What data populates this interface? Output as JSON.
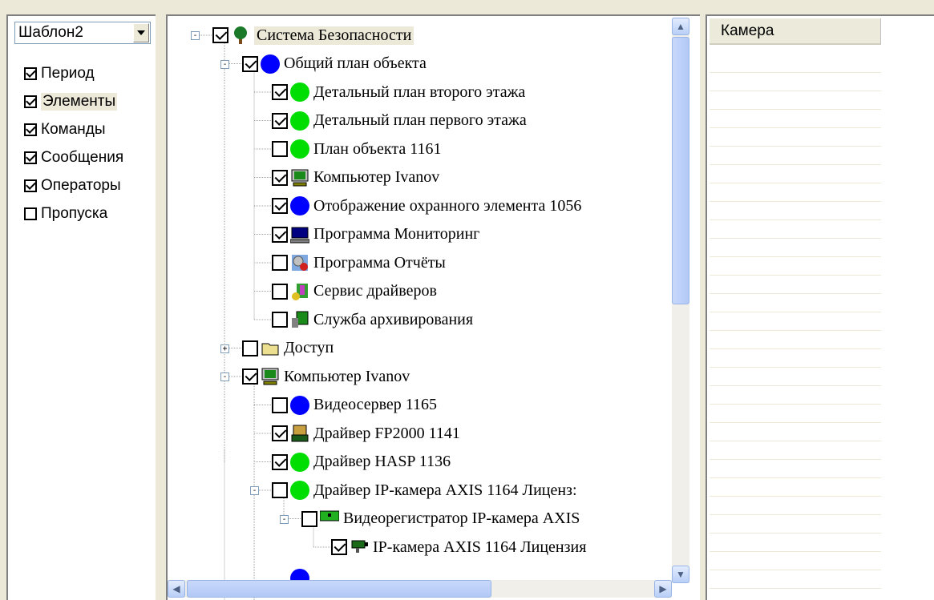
{
  "left_panel": {
    "template_value": "Шаблон2",
    "items": [
      {
        "label": "Период",
        "checked": true
      },
      {
        "label": "Элементы",
        "checked": true,
        "selected": true
      },
      {
        "label": "Команды",
        "checked": true
      },
      {
        "label": "Сообщения",
        "checked": true
      },
      {
        "label": "Операторы",
        "checked": true
      },
      {
        "label": "Пропуска",
        "checked": false
      }
    ]
  },
  "tree": [
    {
      "label": "Система Безопасности",
      "checked": true,
      "icon": "tree-icon",
      "level": 0,
      "expander": "-"
    },
    {
      "label": "Общий план объекта",
      "checked": true,
      "icon": "blue-circle-icon",
      "level": 1,
      "expander": "-"
    },
    {
      "label": "Детальный план второго этажа",
      "checked": true,
      "icon": "green-circle-icon",
      "level": 2
    },
    {
      "label": "Детальный план первого этажа",
      "checked": true,
      "icon": "green-circle-icon",
      "level": 2
    },
    {
      "label": "План объекта 1161",
      "checked": false,
      "icon": "green-circle-icon",
      "level": 2
    },
    {
      "label": "Компьютер Ivanov",
      "checked": true,
      "icon": "computer-icon",
      "level": 2
    },
    {
      "label": "Отображение охранного элемента 1056",
      "checked": true,
      "icon": "blue-circle-icon",
      "level": 2
    },
    {
      "label": "Программа Мониторинг",
      "checked": true,
      "icon": "monitor-program-icon",
      "level": 2
    },
    {
      "label": "Программа Отчёты",
      "checked": false,
      "icon": "reports-program-icon",
      "level": 2
    },
    {
      "label": "Сервис драйверов",
      "checked": false,
      "icon": "driver-service-icon",
      "level": 2
    },
    {
      "label": "Служба архивирования",
      "checked": false,
      "icon": "archive-service-icon",
      "level": 2
    },
    {
      "label": "Доступ",
      "checked": false,
      "icon": "folder-icon",
      "level": 1,
      "expander": "+"
    },
    {
      "label": "Компьютер Ivanov",
      "checked": true,
      "icon": "computer-icon",
      "level": 1,
      "expander": "-"
    },
    {
      "label": "Видеосервер 1165",
      "checked": false,
      "icon": "blue-circle-icon",
      "level": 2
    },
    {
      "label": "Драйвер FP2000 1141",
      "checked": true,
      "icon": "fp-driver-icon",
      "level": 2
    },
    {
      "label": "Драйвер HASP 1136",
      "checked": true,
      "icon": "green-circle-icon",
      "level": 2
    },
    {
      "label": "Драйвер IP-камера AXIS 1164  Лиценз:",
      "checked": false,
      "icon": "green-circle-icon",
      "level": 2,
      "expander": "-"
    },
    {
      "label": "Видеорегистратор IP-камера AXIS",
      "checked": false,
      "icon": "video-recorder-icon",
      "level": 3,
      "expander": "-"
    },
    {
      "label": "IP-камера AXIS 1164  Лицензия",
      "checked": true,
      "icon": "ip-camera-icon",
      "level": 4
    }
  ],
  "right_panel": {
    "column_header": "Камера"
  },
  "colors": {
    "face": "#ece9d8",
    "green": "#00dd00",
    "blue": "#0000ff"
  }
}
